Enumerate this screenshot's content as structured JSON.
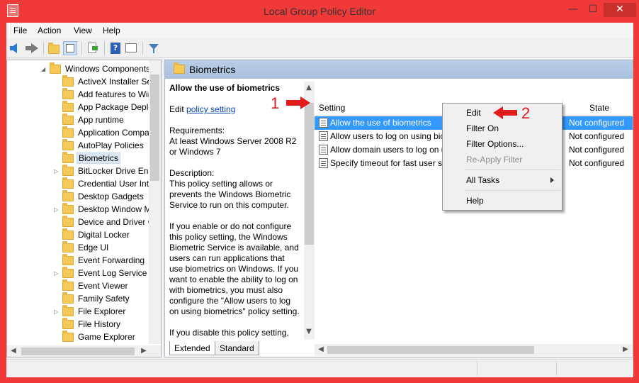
{
  "window": {
    "title": "Local Group Policy Editor",
    "min": "—",
    "max": "☐",
    "close": "✕"
  },
  "menu": [
    "File",
    "Action",
    "View",
    "Help"
  ],
  "tree": {
    "items": [
      {
        "label": "Windows Components",
        "expanded": true
      },
      {
        "label": "ActiveX Installer Service"
      },
      {
        "label": "Add features to Windows"
      },
      {
        "label": "App Package Deployment"
      },
      {
        "label": "App runtime"
      },
      {
        "label": "Application Compatibility"
      },
      {
        "label": "AutoPlay Policies"
      },
      {
        "label": "Biometrics",
        "selected": true
      },
      {
        "label": "BitLocker Drive Encryption",
        "collapsed": true
      },
      {
        "label": "Credential User Interface"
      },
      {
        "label": "Desktop Gadgets"
      },
      {
        "label": "Desktop Window Manager",
        "collapsed": true
      },
      {
        "label": "Device and Driver Compatibility"
      },
      {
        "label": "Digital Locker"
      },
      {
        "label": "Edge UI"
      },
      {
        "label": "Event Forwarding"
      },
      {
        "label": "Event Log Service",
        "collapsed": true
      },
      {
        "label": "Event Viewer"
      },
      {
        "label": "Family Safety"
      },
      {
        "label": "File Explorer",
        "collapsed": true
      },
      {
        "label": "File History"
      },
      {
        "label": "Game Explorer"
      }
    ]
  },
  "header": {
    "title": "Biometrics"
  },
  "description": {
    "title": "Allow the use of biometrics",
    "edit_prefix": "Edit ",
    "edit_link": "policy setting",
    "requirements_label": "Requirements:",
    "requirements": "At least Windows Server 2008 R2 or Windows 7",
    "description_label": "Description:",
    "description": "This policy setting allows or prevents the Windows Biometric Service to run on this computer.",
    "enable_text": "If you enable or do not configure this policy setting, the Windows Biometric Service is available, and users can run applications that use biometrics on Windows. If you want to enable the ability to log on with biometrics, you must also configure the \"Allow users to log on using biometrics\" policy setting.",
    "disable_text": "If you disable this policy setting,"
  },
  "list": {
    "col_setting": "Setting",
    "col_state": "State",
    "rows": [
      {
        "name": "Allow the use of biometrics",
        "state": "Not configured",
        "selected": true
      },
      {
        "name": "Allow users to log on using biometrics",
        "state": "Not configured"
      },
      {
        "name": "Allow domain users to log on using biometrics",
        "state": "Not configured"
      },
      {
        "name": "Specify timeout for fast user switching events",
        "state": "Not configured"
      }
    ]
  },
  "tabs": [
    "Extended",
    "Standard"
  ],
  "context_menu": {
    "items": [
      {
        "label": "Edit"
      },
      {
        "label": "Filter On"
      },
      {
        "label": "Filter Options..."
      },
      {
        "label": "Re-Apply Filter",
        "disabled": true
      },
      {
        "label": "All Tasks",
        "submenu": true
      },
      {
        "label": "Help"
      }
    ]
  },
  "annotations": {
    "one": "1",
    "two": "2",
    "color": "#e31b1b"
  },
  "colors": {
    "frame": "#f03a3a",
    "selection": "#3399ff",
    "header": "#b9cde6"
  }
}
